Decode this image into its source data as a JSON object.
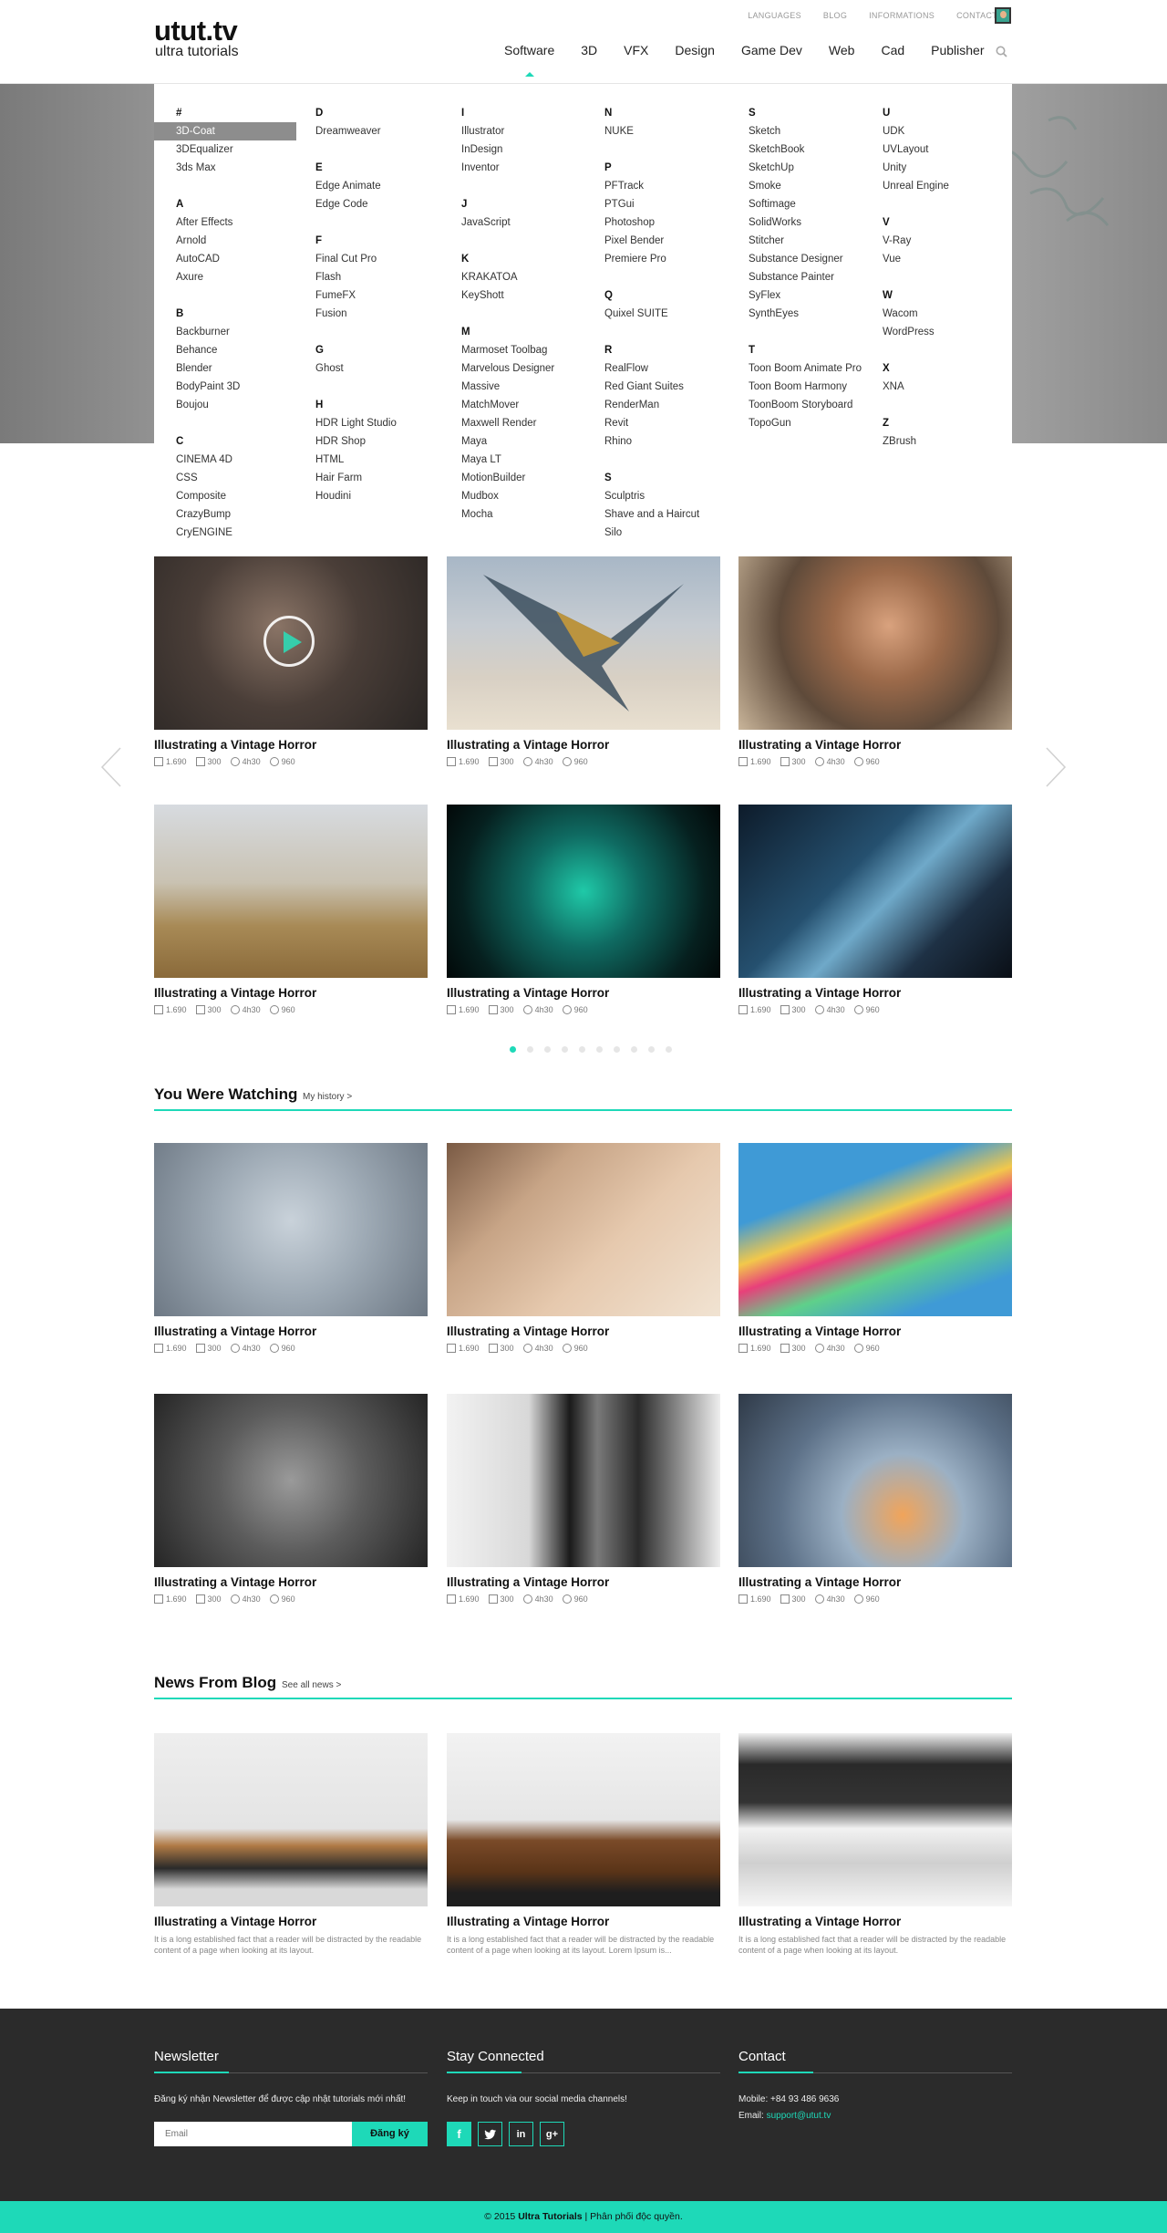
{
  "header": {
    "logo": "utut.tv",
    "tagline": "ultra tutorials",
    "top_links": [
      "LANGUAGES",
      "BLOG",
      "INFORMATIONS",
      "CONTACT"
    ],
    "nav": [
      "Software",
      "3D",
      "VFX",
      "Design",
      "Game Dev",
      "Web",
      "Cad",
      "Publisher"
    ],
    "active_nav": "Software"
  },
  "mega_menu": {
    "col1": {
      "g1": {
        "h": "#",
        "items": [
          "3D-Coat",
          "3DEqualizer",
          "3ds Max"
        ]
      },
      "g2": {
        "h": "A",
        "items": [
          "After Effects",
          "Arnold",
          "AutoCAD",
          "Axure"
        ]
      },
      "g3": {
        "h": "B",
        "items": [
          "Backburner",
          "Behance",
          "Blender",
          "BodyPaint 3D",
          "Boujou"
        ]
      },
      "g4": {
        "h": "C",
        "items": [
          "CINEMA 4D",
          "CSS",
          "Composite",
          "CrazyBump",
          "CryENGINE"
        ]
      }
    },
    "col2": {
      "g1": {
        "h": "D",
        "items": [
          "Dreamweaver"
        ]
      },
      "g2": {
        "h": "E",
        "items": [
          "Edge Animate",
          "Edge Code"
        ]
      },
      "g3": {
        "h": "F",
        "items": [
          "Final Cut Pro",
          "Flash",
          "FumeFX",
          "Fusion"
        ]
      },
      "g4": {
        "h": "G",
        "items": [
          "Ghost"
        ]
      },
      "g5": {
        "h": "H",
        "items": [
          "HDR Light Studio",
          "HDR Shop",
          "HTML",
          "Hair Farm",
          "Houdini"
        ]
      }
    },
    "col3": {
      "g1": {
        "h": "I",
        "items": [
          "Illustrator",
          "InDesign",
          "Inventor"
        ]
      },
      "g2": {
        "h": "J",
        "items": [
          "JavaScript"
        ]
      },
      "g3": {
        "h": "K",
        "items": [
          "KRAKATOA",
          "KeyShott"
        ]
      },
      "g4": {
        "h": "M",
        "items": [
          "Marmoset Toolbag",
          "Marvelous Designer",
          "Massive",
          "MatchMover",
          "Maxwell Render",
          "Maya",
          "Maya LT",
          "MotionBuilder",
          "Mudbox",
          "Mocha"
        ]
      }
    },
    "col4": {
      "g1": {
        "h": "N",
        "items": [
          "NUKE"
        ]
      },
      "g2": {
        "h": "P",
        "items": [
          "PFTrack",
          "PTGui",
          "Photoshop",
          "Pixel Bender",
          "Premiere Pro"
        ]
      },
      "g3": {
        "h": "Q",
        "items": [
          "Quixel SUITE"
        ]
      },
      "g4": {
        "h": "R",
        "items": [
          "RealFlow",
          "Red Giant Suites",
          "RenderMan",
          "Revit",
          "Rhino"
        ]
      },
      "g5": {
        "h": "S",
        "items": [
          "Sculptris",
          "Shave and a Haircut",
          "Silo"
        ]
      }
    },
    "col5": {
      "g1": {
        "h": "S",
        "items": [
          "Sketch",
          "SketchBook",
          "SketchUp",
          "Smoke",
          "Softimage",
          "SolidWorks",
          "Stitcher",
          "Substance Designer",
          "Substance Painter",
          "SyFlex",
          "SynthEyes"
        ]
      },
      "g2": {
        "h": "T",
        "items": [
          "Toon Boom Animate Pro",
          "Toon Boom Harmony",
          "ToonBoom Storyboard",
          "TopoGun"
        ]
      }
    },
    "col6": {
      "g1": {
        "h": "U",
        "items": [
          "UDK",
          "UVLayout",
          "Unity",
          "Unreal Engine"
        ]
      },
      "g2": {
        "h": "V",
        "items": [
          "V-Ray",
          "Vue"
        ]
      },
      "g3": {
        "h": "W",
        "items": [
          "Wacom",
          "WordPress"
        ]
      },
      "g4": {
        "h": "X",
        "items": [
          "XNA"
        ]
      },
      "g5": {
        "h": "Z",
        "items": [
          "ZBrush"
        ]
      }
    },
    "selected": "3D-Coat"
  },
  "card": {
    "title": "Illustrating a Vintage Horror",
    "views": "1.690",
    "likes": "300",
    "duration": "4h30",
    "count": "960"
  },
  "featured_dots": 10,
  "watching": {
    "title": "You Were Watching",
    "link": "My history >"
  },
  "blog": {
    "title": "News From Blog",
    "link": "See all news >",
    "desc1": "It is a long established fact that a reader will be distracted by the readable content of a page when looking at its layout.",
    "desc2": "It is a long established fact that a reader will be distracted by the readable content of a page when looking at its layout. Lorem Ipsum is..."
  },
  "footer": {
    "newsletter_title": "Newsletter",
    "newsletter_text": "Đăng ký nhận Newsletter để được cập nhật tutorials mới nhất!",
    "email_placeholder": "Email",
    "subscribe": "Đăng ký",
    "social_title": "Stay Connected",
    "social_text": "Keep in touch via our social media channels!",
    "social": [
      "f",
      "t",
      "in",
      "g+"
    ],
    "contact_title": "Contact",
    "mobile": "Mobile: +84 93 486 9636",
    "email_label": "Email:",
    "email": "support@utut.tv",
    "copyright_pre": "© 2015",
    "copyright_brand": "Ultra Tutorials",
    "copyright_post": "| Phân phối độc quyền."
  },
  "colors": {
    "accent": "#1ed9b8",
    "footer_bg": "#2b2b2b"
  }
}
